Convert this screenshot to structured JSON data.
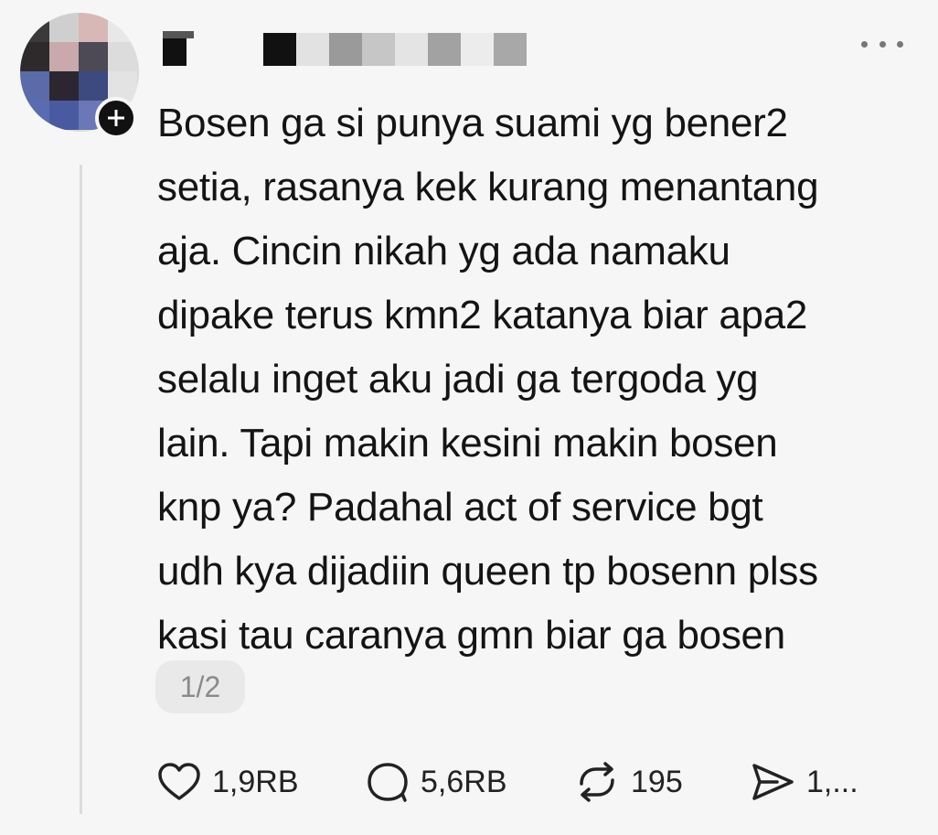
{
  "post": {
    "text": "Bosen ga si punya suami yg bener2\nsetia, rasanya kek kurang menantang\naja. Cincin nikah yg ada namaku\ndipake terus kmn2 katanya biar apa2\nselalu inget aku jadi ga tergoda yg\nlain. Tapi makin kesini makin bosen\nknp ya? Padahal act of service bgt\nudh kya dijadiin queen tp bosenn plss\nkasi tau caranya gmn biar ga bosen",
    "page_indicator": "1/2"
  },
  "header": {
    "more_icon": "more-horizontal-icon",
    "follow_icon": "plus-icon"
  },
  "stats": {
    "likes": "1,9RB",
    "replies": "5,6RB",
    "reposts": "195",
    "shares": "1,..."
  },
  "icons": {
    "like": "heart-icon",
    "reply": "comment-bubble-icon",
    "repost": "repost-icon",
    "share": "send-icon"
  },
  "colors": {
    "background": "#f6f6f6",
    "text": "#141414",
    "muted": "#8a8a8a"
  }
}
